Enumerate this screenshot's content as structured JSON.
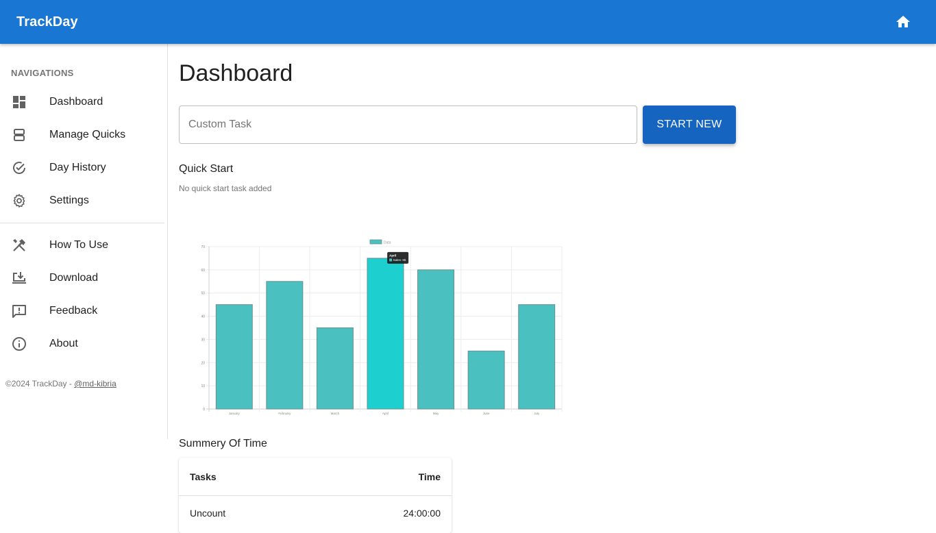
{
  "app": {
    "title": "TrackDay"
  },
  "sidebar": {
    "header": "NAVIGATIONS",
    "items": [
      {
        "label": "Dashboard",
        "icon": "dashboard-icon"
      },
      {
        "label": "Manage Quicks",
        "icon": "view-agenda-icon"
      },
      {
        "label": "Day History",
        "icon": "check-circle-icon"
      },
      {
        "label": "Settings",
        "icon": "gear-icon"
      },
      {
        "label": "How To Use",
        "icon": "tools-icon"
      },
      {
        "label": "Download",
        "icon": "download-icon"
      },
      {
        "label": "Feedback",
        "icon": "feedback-icon"
      },
      {
        "label": "About",
        "icon": "info-icon"
      }
    ],
    "footer_text": "©2024 TrackDay - ",
    "footer_link": "@md-kibria"
  },
  "main": {
    "title": "Dashboard",
    "task_input": {
      "placeholder": "Custom Task",
      "value": ""
    },
    "start_button": "START NEW",
    "quick_start": {
      "title": "Quick Start",
      "empty_text": "No quick start task added"
    },
    "summary": {
      "title": "Summery Of Time",
      "columns": [
        "Tasks",
        "Time"
      ],
      "rows": [
        {
          "task": "Uncount",
          "time": "24:00:00"
        }
      ]
    }
  },
  "colors": {
    "appbar": "#1976d2",
    "button": "#1565c0",
    "bar": "#4bc0c0",
    "bar_hover": "#1ecfcf"
  },
  "chart_data": {
    "type": "bar",
    "categories": [
      "January",
      "February",
      "March",
      "April",
      "May",
      "June",
      "July"
    ],
    "series": [
      {
        "name": "Data",
        "values": [
          45,
          55,
          35,
          65,
          60,
          25,
          45
        ]
      }
    ],
    "ylim": [
      0,
      70
    ],
    "yticks": [
      0,
      10,
      20,
      30,
      40,
      50,
      60,
      70
    ],
    "grid": true,
    "legend": "top",
    "tooltip": {
      "category": "April",
      "label": "Sales",
      "value": 65
    }
  }
}
